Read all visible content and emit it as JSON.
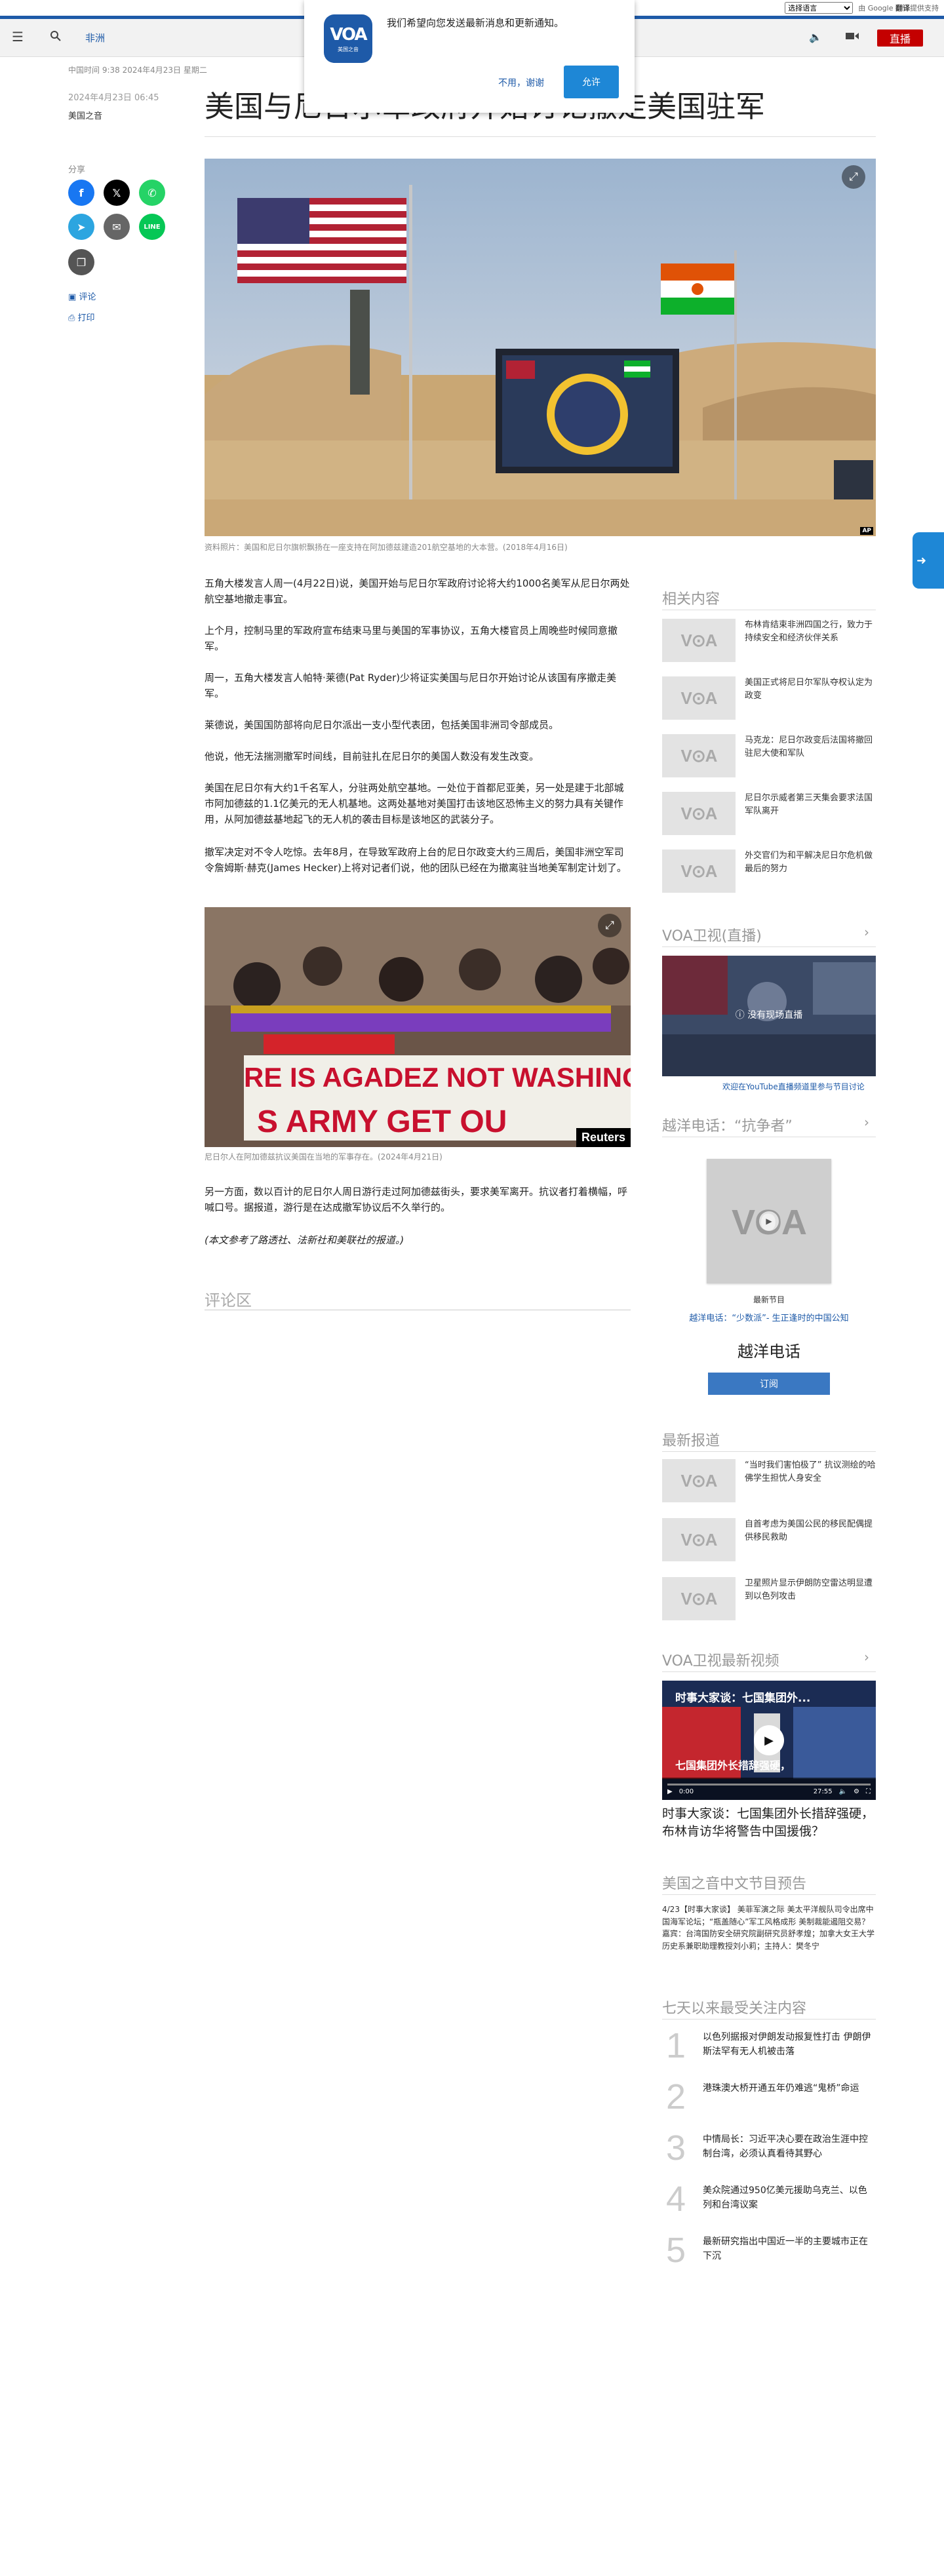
{
  "translate": {
    "select_label": "选择语言",
    "powered_by": "由 Google",
    "translate_word": "翻译",
    "provided": "提供支持"
  },
  "header": {
    "section": "非洲",
    "live": "直播"
  },
  "notification": {
    "logo_text": "VOA",
    "logo_sub": "美国之音",
    "message": "我们希望向您发送最新消息和更新通知。",
    "decline": "不用，谢谢",
    "accept": "允许"
  },
  "article": {
    "date_line": "中国时间 9:38 2024年4月23日 星期二",
    "pub_date": "2024年4月23日 06:45",
    "byline": "美国之音",
    "title": "美国与尼日尔军政府开始讨论撤走美国驻军",
    "share_label": "分享",
    "comments_link": "评论",
    "print_link": "打印",
    "hero_caption": "资料照片：美国和尼日尔旗帜飘扬在一座支持在阿加德兹建造201航空基地的大本营。(2018年4月16日)",
    "paragraphs": [
      "五角大楼发言人周一(4月22日)说，美国开始与尼日尔军政府讨论将大约1000名美军从尼日尔两处航空基地撤走事宜。",
      "上个月，控制马里的军政府宣布结束马里与美国的军事协议，五角大楼官员上周晚些时候同意撤军。",
      "周一，五角大楼发言人帕特·莱德(Pat Ryder)少将证实美国与尼日尔开始讨论从该国有序撤走美军。",
      "莱德说，美国国防部将向尼日尔派出一支小型代表团，包括美国非洲司令部成员。",
      "他说，他无法揣测撤军时间线，目前驻扎在尼日尔的美国人数没有发生改变。",
      "美国在尼日尔有大约1千名军人，分驻两处航空基地。一处位于首都尼亚美，另一处是建于北部城市阿加德兹的1.1亿美元的无人机基地。这两处基地对美国打击该地区恐怖主义的努力具有关键作用，从阿加德兹基地起飞的无人机的袭击目标是该地区的武装分子。",
      "撤军决定对不令人吃惊。去年8月，在导致军政府上台的尼日尔政变大约三周后，美国非洲空军司令詹姆斯·赫克(James Hecker)上将对记者们说，他的团队已经在为撤离驻当地美军制定计划了。",
      "另一方面，数以百计的尼日尔人周日游行走过阿加德兹街头，要求美军离开。抗议者打着横幅，呼喊口号。据报道，游行是在达成撤军协议后不久举行的。",
      "(本文参考了路透社、法新社和美联社的报道。)"
    ],
    "img2_caption": "尼日尔人在阿加德兹抗议美国在当地的军事存在。(2024年4月21日)",
    "img2_banner_1": "RE IS AGADEZ  NOT WASHING",
    "img2_banner_2": "S ARMY GET OU",
    "img2_credit": "Reuters",
    "hero_credit": "AP",
    "comments_heading": "评论区"
  },
  "sidebar": {
    "related_heading": "相关内容",
    "related": [
      "布林肯结束非洲四国之行，致力于持续安全和经济伙伴关系",
      "美国正式将尼日尔军队夺权认定为政变",
      "马克龙：尼日尔政变后法国将撤回驻尼大使和军队",
      "尼日尔示威者第三天集会要求法国军队离开",
      "外交官们为和平解决尼日尔危机做最后的努力"
    ],
    "tv_heading": "VOA卫视(直播)",
    "tv_message": "没有现场直播",
    "tv_youtube": "欢迎在YouTube直播频道里参与节目讨论",
    "radio_heading": "越洋电话：“抗争者”",
    "radio_latest": "最新节目",
    "radio_episode": "越洋电话：“少数派”- 生正逢时的中国公知",
    "radio_name": "越洋电话",
    "radio_subscribe": "订阅",
    "latest_heading": "最新报道",
    "latest": [
      "“当时我们害怕极了” 抗议测绘的哈佛学生担忧人身安全",
      "自首考虑为美国公民的移民配偶提供移民救助",
      "卫星照片显示伊朗防空雷达明显遭到以色列攻击"
    ],
    "video_heading": "VOA卫视最新视频",
    "video_overlay_title": "时事大家谈：七国集团外...",
    "video_overlay_banner": "七国集团外长措辞强硬，",
    "video_time_current": "0:00",
    "video_time_total": "27:55",
    "video_title": "时事大家谈：七国集团外长措辞强硬，布林肯访华将警告中国援俄？",
    "schedule_heading": "美国之音中文节目预告",
    "schedule_text": "4/23【时事大家谈】 美菲军演之际 美太平洋舰队司令出席中国海军论坛；“瓶盖随心”军工风格成形 美制裁能遏阻交易？ 嘉宾：台湾国防安全研究院副研究员舒孝煌；加拿大女王大学历史系兼职助理教授刘小莉；主持人：樊冬宁",
    "popular_heading": "七天以来最受关注内容",
    "popular": [
      {
        "num": "1",
        "title": "以色列据报对伊朗发动报复性打击 伊朗伊斯法罕有无人机被击落"
      },
      {
        "num": "2",
        "title": "港珠澳大桥开通五年仍难逃“鬼桥”命运"
      },
      {
        "num": "3",
        "title": "中情局长：习近平决心要在政治生涯中控制台湾，必须认真看待其野心"
      },
      {
        "num": "4",
        "title": "美众院通过950亿美元援助乌克兰、以色列和台湾议案"
      },
      {
        "num": "5",
        "title": "最新研究指出中国近一半的主要城市正在下沉"
      }
    ]
  },
  "colors": {
    "brand_blue": "#1e5aa8",
    "live_red": "#c40000",
    "link_blue": "#1e5aa8"
  }
}
